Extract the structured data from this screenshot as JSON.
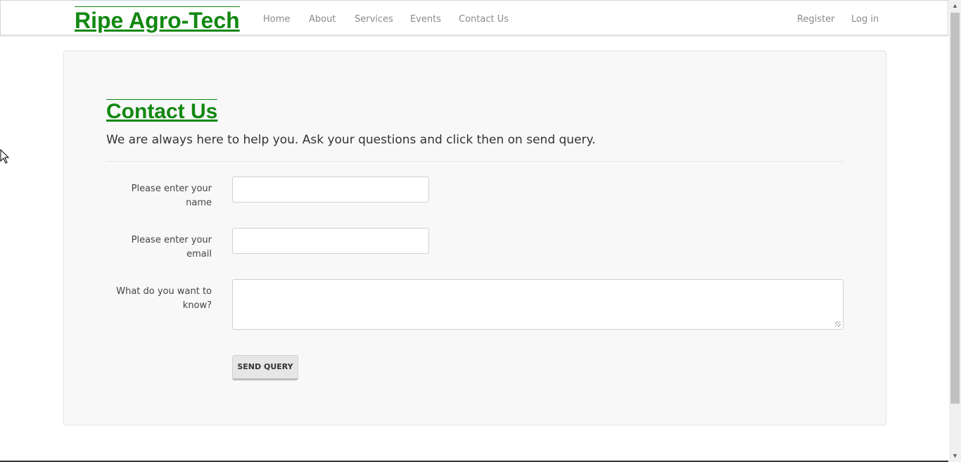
{
  "nav": {
    "brand": "Ripe Agro-Tech",
    "links": [
      "Home",
      "About",
      "Services",
      "Events",
      "Contact Us"
    ],
    "right": [
      "Register",
      "Log in"
    ]
  },
  "contact": {
    "title": "Contact Us",
    "lead": "We are always here to help you. Ask your questions and click then on send query.",
    "name_label": "Please enter your name",
    "name_value": "",
    "email_label": "Please enter your email",
    "email_value": "",
    "question_label": "What do you want to know?",
    "question_value": "",
    "submit_label": "SEND QUERY"
  },
  "colors": {
    "brand": "#118811",
    "panel": "#f8f8f8"
  }
}
